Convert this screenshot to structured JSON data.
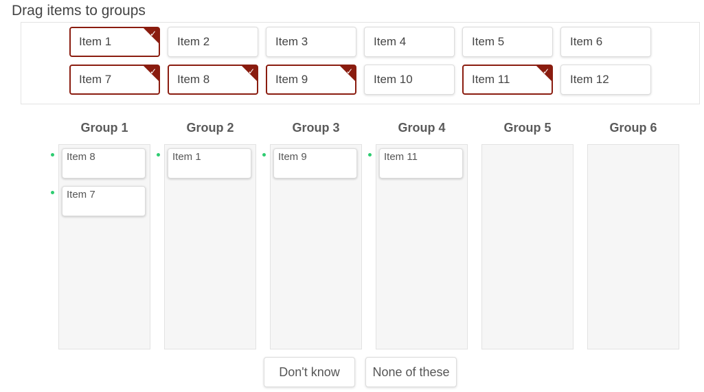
{
  "title": "Drag items to groups",
  "accent_color": "#8a1c0f",
  "dot_color": "#2ecc71",
  "check_glyph": "✓",
  "items": [
    {
      "label": "Item 1",
      "selected": true
    },
    {
      "label": "Item 2",
      "selected": false
    },
    {
      "label": "Item 3",
      "selected": false
    },
    {
      "label": "Item 4",
      "selected": false
    },
    {
      "label": "Item 5",
      "selected": false
    },
    {
      "label": "Item 6",
      "selected": false
    },
    {
      "label": "Item 7",
      "selected": true
    },
    {
      "label": "Item 8",
      "selected": true
    },
    {
      "label": "Item 9",
      "selected": true
    },
    {
      "label": "Item 10",
      "selected": false
    },
    {
      "label": "Item 11",
      "selected": true
    },
    {
      "label": "Item 12",
      "selected": false
    }
  ],
  "groups": [
    {
      "label": "Group 1",
      "items": [
        "Item 8",
        "Item 7"
      ]
    },
    {
      "label": "Group 2",
      "items": [
        "Item 1"
      ]
    },
    {
      "label": "Group 3",
      "items": [
        "Item 9"
      ]
    },
    {
      "label": "Group 4",
      "items": [
        "Item 11"
      ]
    },
    {
      "label": "Group 5",
      "items": []
    },
    {
      "label": "Group 6",
      "items": []
    }
  ],
  "buttons": {
    "dont_know": "Don't know",
    "none_of_these": "None of these"
  }
}
